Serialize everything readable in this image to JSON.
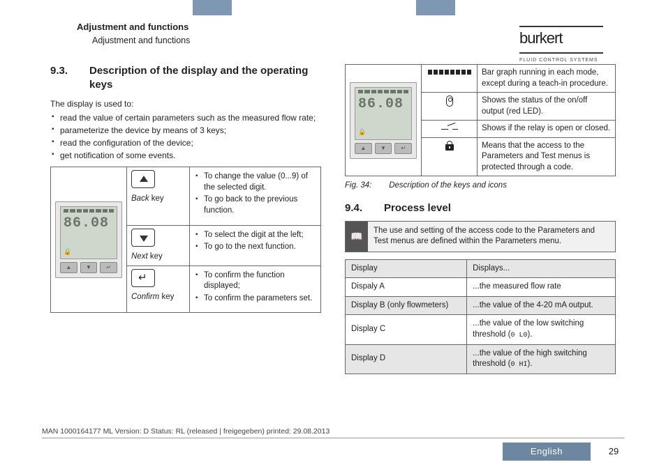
{
  "header": {
    "title_bold": "Adjustment and functions",
    "title_plain": "Adjustment and functions",
    "logo_main": "burkert",
    "logo_sub": "FLUID CONTROL SYSTEMS"
  },
  "section93": {
    "num": "9.3.",
    "title": "Description of the display and the operating keys",
    "intro": "The display is used to:",
    "uses": [
      "read the value of certain parameters such as the measured flow rate;",
      "parameterize the device by means of 3 keys;",
      "read the configuration of the device;",
      "get notification of some events."
    ],
    "keys": [
      {
        "name": "Back",
        "label_suffix": " key",
        "funcs": [
          "To change the value (0...9) of the selected digit.",
          "To go back to the previous function."
        ]
      },
      {
        "name": "Next",
        "label_suffix": " key",
        "funcs": [
          "To select the digit at the left;",
          "To go to the next function."
        ]
      },
      {
        "name": "Confirm",
        "label_suffix": " key",
        "funcs": [
          "To confirm the function displayed;",
          "To confirm the parameters set."
        ]
      }
    ],
    "device_digits": "86.08"
  },
  "icons_table": [
    {
      "id": "bargraph",
      "desc": "Bar graph running in each mode, except during a teach-in procedure."
    },
    {
      "id": "led",
      "desc": "Shows the status of the on/off output (red LED)."
    },
    {
      "id": "relay",
      "desc": "Shows if the relay is open or closed."
    },
    {
      "id": "lock",
      "desc": "Means that the access to the Parameters and Test menus is protected through a code."
    }
  ],
  "fig34": {
    "num": "Fig. 34:",
    "text": "Description of the keys and icons"
  },
  "section94": {
    "num": "9.4.",
    "title": "Process level",
    "note": "The use and setting of the access code to the Parameters and Test menus are defined within the Parameters menu.",
    "table_header": {
      "c1": "Display",
      "c2": "Displays..."
    },
    "rows": [
      {
        "c1": "Dispaly A",
        "c2": "...the measured flow rate",
        "shade": false
      },
      {
        "c1": "Display B (only flowmeters)",
        "c2": "...the value of the 4-20 mA output.",
        "shade": true
      },
      {
        "c1": "Display C",
        "c2_pre": "...the value of the low switching threshold (",
        "code": "0 L0",
        "c2_post": ").",
        "shade": false
      },
      {
        "c1": "Display D",
        "c2_pre": "...the value of the high switching threshold (",
        "code": "0 HI",
        "c2_post": ").",
        "shade": true
      }
    ]
  },
  "footer": {
    "meta": "MAN 1000164177 ML Version: D Status: RL (released | freigegeben) printed: 29.08.2013",
    "lang": "English",
    "page": "29"
  }
}
